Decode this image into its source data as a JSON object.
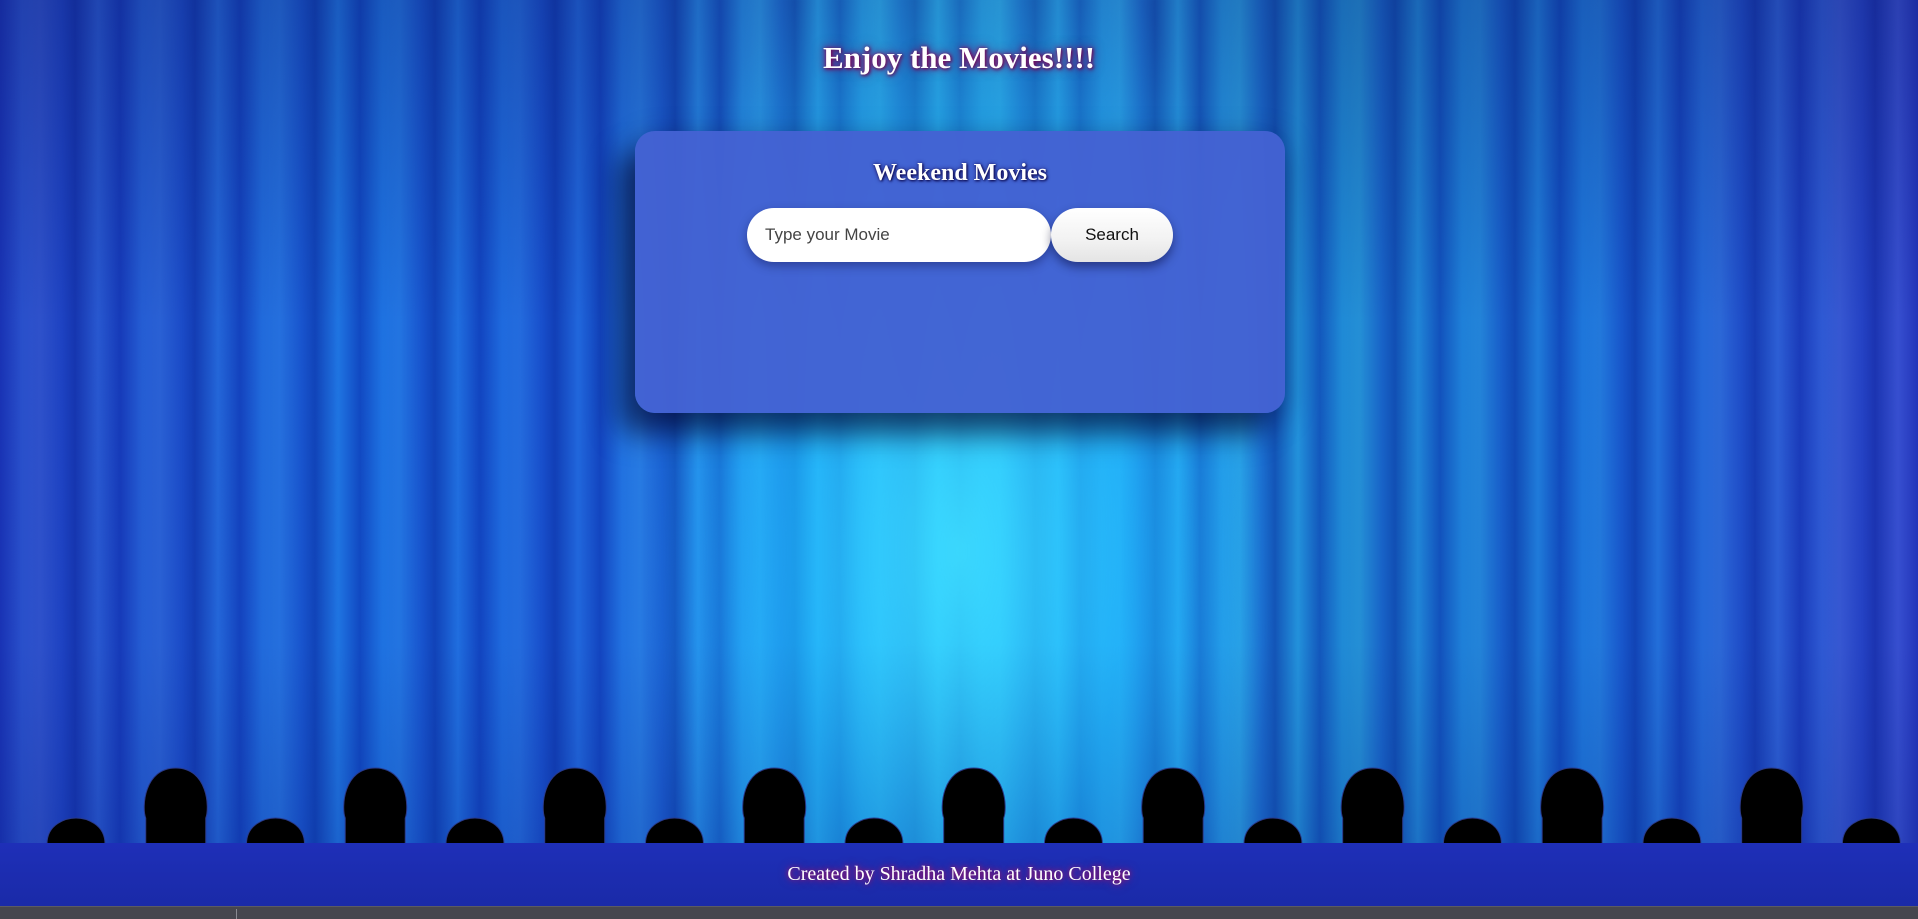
{
  "page": {
    "title": "Enjoy the Movies!!!!"
  },
  "search_panel": {
    "heading": "Weekend Movies",
    "input_placeholder": "Type your Movie",
    "input_value": "",
    "button_label": "Search"
  },
  "footer": {
    "credit": "Created by Shradha Mehta at Juno College"
  },
  "colors": {
    "panel": "#4462d2",
    "footer": "#1e2fb8",
    "title_glow": "#8a0f6a"
  },
  "audience": {
    "silhouette_count": 19
  }
}
